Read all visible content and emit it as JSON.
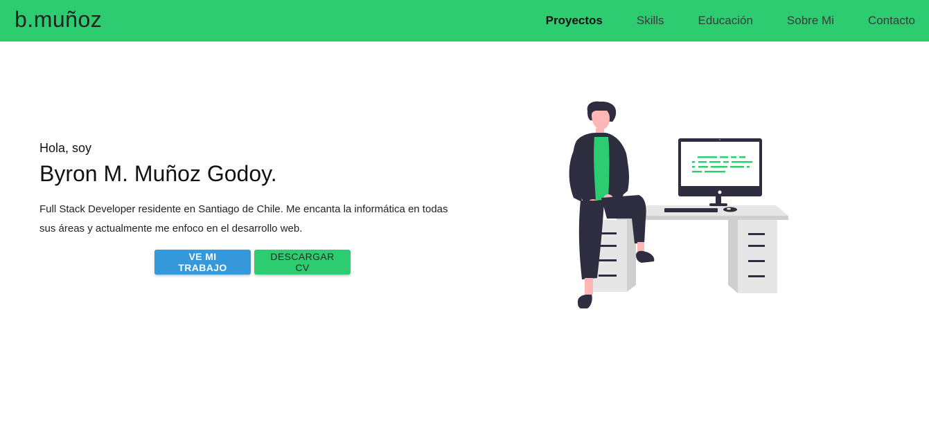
{
  "header": {
    "brand": "b.muñoz",
    "nav": [
      {
        "label": "Proyectos",
        "active": true
      },
      {
        "label": "Skills",
        "active": false
      },
      {
        "label": "Educación",
        "active": false
      },
      {
        "label": "Sobre Mi",
        "active": false
      },
      {
        "label": "Contacto",
        "active": false
      }
    ]
  },
  "hero": {
    "greeting": "Hola, soy",
    "name": "Byron M. Muñoz Godoy.",
    "description": "Full Stack Developer residente en Santiago de Chile. Me encanta la informática en todas sus áreas y actualmente me enfoco en el desarrollo web.",
    "primary_button": "VE MI TRABAJO",
    "secondary_button": "DESCARGAR CV"
  },
  "colors": {
    "accent_green": "#2ecc71",
    "accent_blue": "#3498db",
    "dark": "#2f2e41",
    "skin": "#ffb6b6"
  },
  "illustration": {
    "icon": "developer-at-desk-illustration"
  }
}
